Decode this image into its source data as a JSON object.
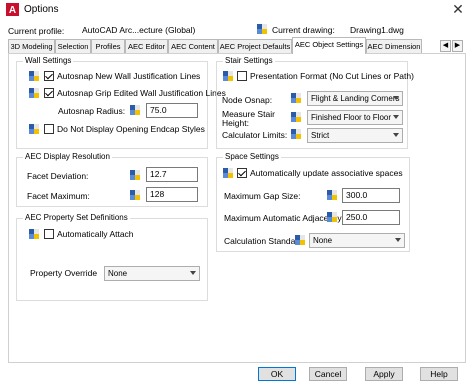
{
  "window": {
    "title": "Options",
    "close_glyph": "✕"
  },
  "profile": {
    "label": "Current profile:",
    "value": "AutoCAD Arc...ecture (Global)"
  },
  "drawing": {
    "label": "Current drawing:",
    "value": "Drawing1.dwg"
  },
  "tabs": [
    {
      "label": "3D Modeling"
    },
    {
      "label": "Selection"
    },
    {
      "label": "Profiles"
    },
    {
      "label": "AEC Editor"
    },
    {
      "label": "AEC Content"
    },
    {
      "label": "AEC Project Defaults"
    },
    {
      "label": "AEC Object Settings",
      "active": true
    },
    {
      "label": "AEC Dimension"
    }
  ],
  "tab_scroll": {
    "left": "◀",
    "right": "▶"
  },
  "wall_settings": {
    "title": "Wall Settings",
    "autosnap_new_label": "Autosnap New Wall Justification Lines",
    "autosnap_new_checked": true,
    "autosnap_grip_label": "Autosnap Grip Edited Wall Justification Lines",
    "autosnap_grip_checked": true,
    "autosnap_radius_label": "Autosnap Radius:",
    "autosnap_radius_value": "75.0",
    "no_endcap_label": "Do Not Display Opening Endcap Styles",
    "no_endcap_checked": false
  },
  "aec_display_resolution": {
    "title": "AEC Display Resolution",
    "facet_deviation_label": "Facet Deviation:",
    "facet_deviation_value": "12.7",
    "facet_maximum_label": "Facet Maximum:",
    "facet_maximum_value": "128"
  },
  "aec_property_set": {
    "title": "AEC Property Set Definitions",
    "auto_attach_label": "Automatically Attach",
    "auto_attach_checked": false,
    "property_override_label": "Property Override",
    "property_override_value": "None"
  },
  "stair_settings": {
    "title": "Stair Settings",
    "presentation_format_label": "Presentation Format (No Cut Lines or Path)",
    "presentation_format_checked": false,
    "node_osnap_label": "Node Osnap:",
    "node_osnap_value": "Flight & Landing Corners",
    "measure_height_label_line1": "Measure Stair",
    "measure_height_label_line2": "Height:",
    "measure_height_value": "Finished Floor to Floor",
    "calculator_limits_label": "Calculator Limits:",
    "calculator_limits_value": "Strict"
  },
  "space_settings": {
    "title": "Space Settings",
    "auto_update_label": "Automatically update associative spaces",
    "auto_update_checked": true,
    "max_gap_label": "Maximum Gap Size:",
    "max_gap_value": "300.0",
    "max_adjacency_label": "Maximum Automatic Adjacency",
    "max_adjacency_value": "250.0",
    "calc_standard_label": "Calculation Standard:",
    "calc_standard_value": "None"
  },
  "buttons": {
    "ok": "OK",
    "cancel": "Cancel",
    "apply": "Apply",
    "help": "Help"
  },
  "colors": {
    "accent": "#0078d7",
    "icon_blue": "#2a5caa",
    "icon_yellow": "#f2c200"
  }
}
